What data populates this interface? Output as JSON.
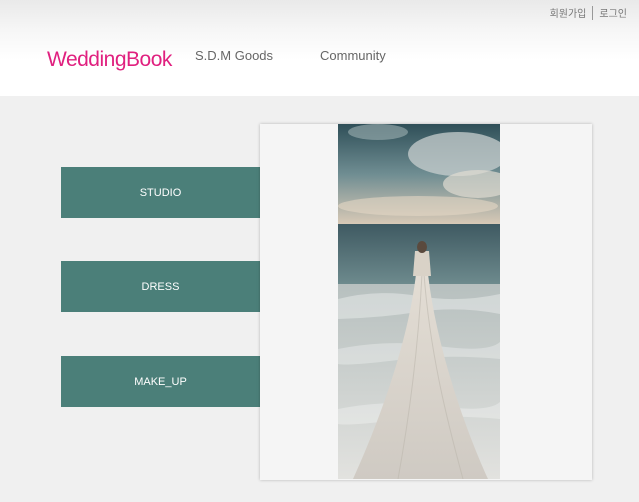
{
  "header": {
    "utility": {
      "signup": "회원가입",
      "login": "로그인"
    },
    "logo": "WeddingBook",
    "nav": {
      "goods": "S.D.M Goods",
      "community": "Community"
    }
  },
  "menu": {
    "studio": "STUDIO",
    "dress": "DRESS",
    "makeup": "MAKE_UP"
  },
  "colors": {
    "brand": "#e0207f",
    "button": "#4b7f79",
    "background": "#f0f0f0"
  }
}
